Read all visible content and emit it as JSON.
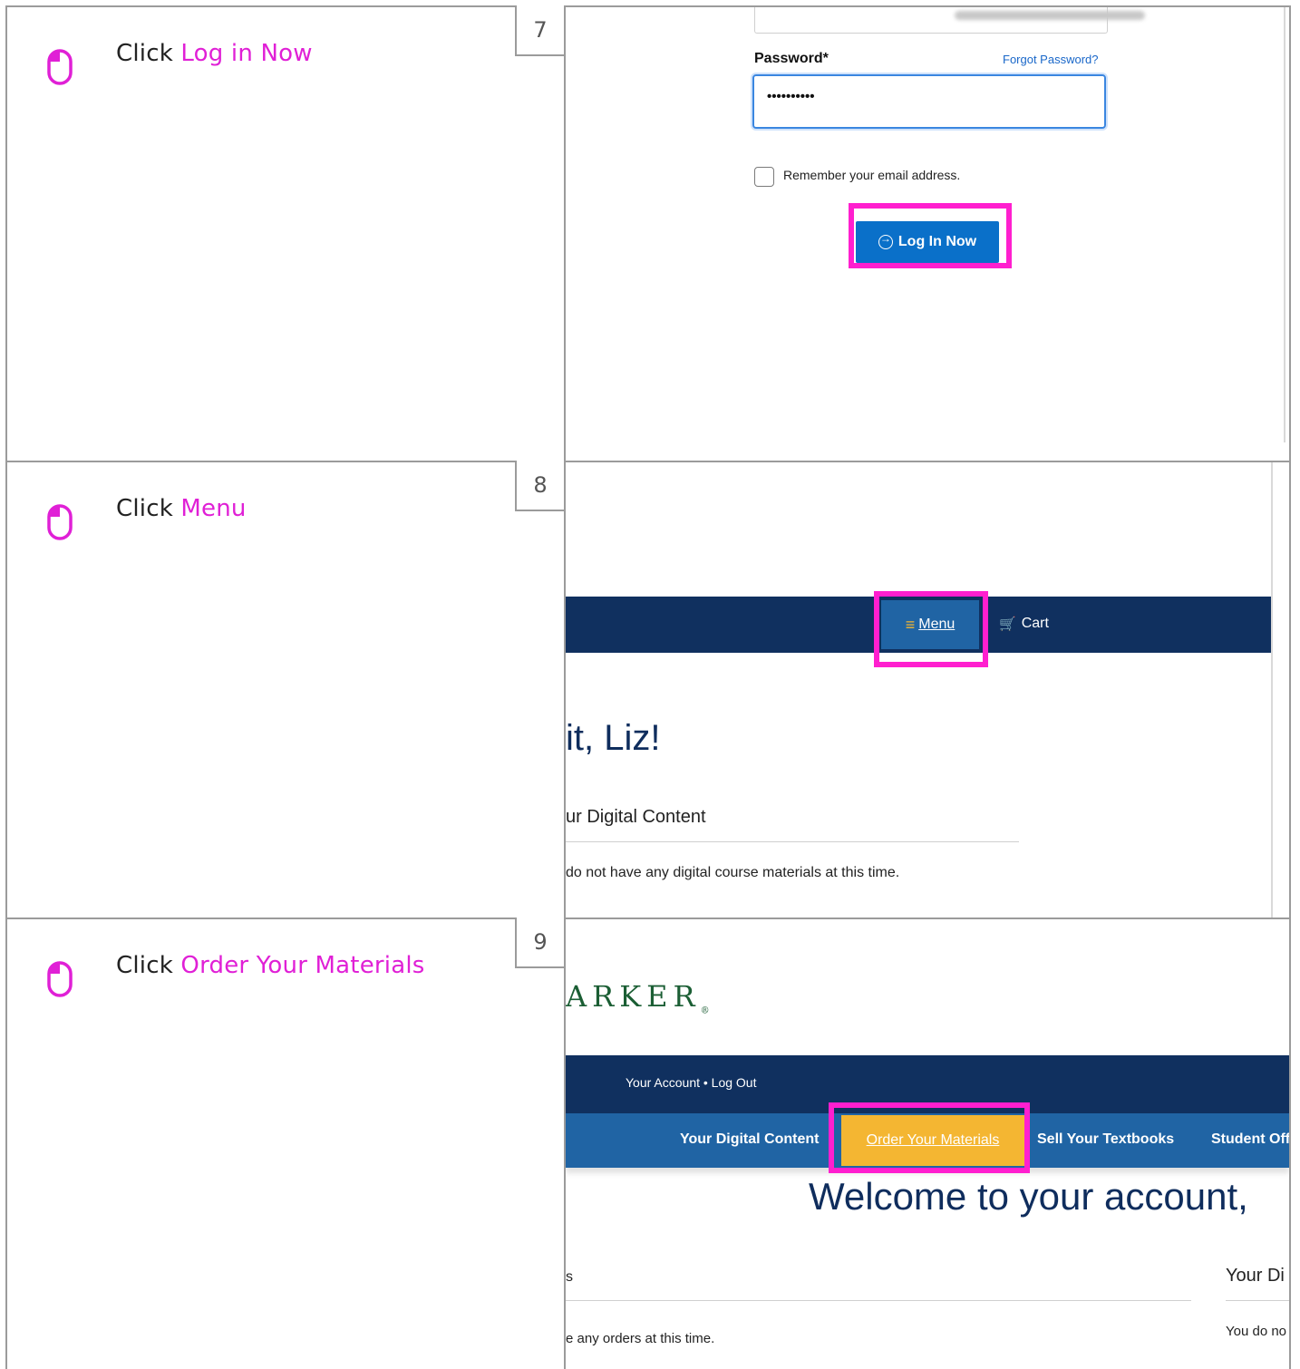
{
  "steps": [
    {
      "number": "7",
      "instruction_prefix": "Click ",
      "instruction_target": "Log in Now",
      "screen": {
        "password_label": "Password*",
        "forgot_link": "Forgot Password?",
        "password_value": "••••••••••",
        "remember_label": "Remember your email address.",
        "login_button": "Log In Now"
      }
    },
    {
      "number": "8",
      "instruction_prefix": "Click ",
      "instruction_target": "Menu",
      "screen": {
        "menu_label": " Menu",
        "cart_label": "Cart",
        "welcome_fragment": "it, Liz!",
        "digital_fragment": "ur Digital Content",
        "no_content_fragment": "do not have any digital course materials at this time."
      }
    },
    {
      "number": "9",
      "instruction_prefix": "Click ",
      "instruction_target": "Order Your Materials",
      "screen": {
        "logo_fragment": "ARKER",
        "logo_mark": "®",
        "account_links": "Your Account • Log Out",
        "nav_items": [
          "Your Digital Content",
          "Order Your Materials",
          "Sell Your Textbooks",
          "Student Off"
        ],
        "welcome_fragment": "Welcome to your account,",
        "orders_col_fragment": "s",
        "no_orders_fragment": "e any orders at this time.",
        "digital_header_fragment": "Your Di",
        "digital_none_fragment": "You do no"
      }
    }
  ],
  "colors": {
    "highlight": "#ff1fcf",
    "instruction_target": "#e020d6",
    "navy": "#10305f",
    "nav_blue": "#2064a4",
    "order_yellow": "#f4b632",
    "button_blue": "#0a70c9"
  }
}
